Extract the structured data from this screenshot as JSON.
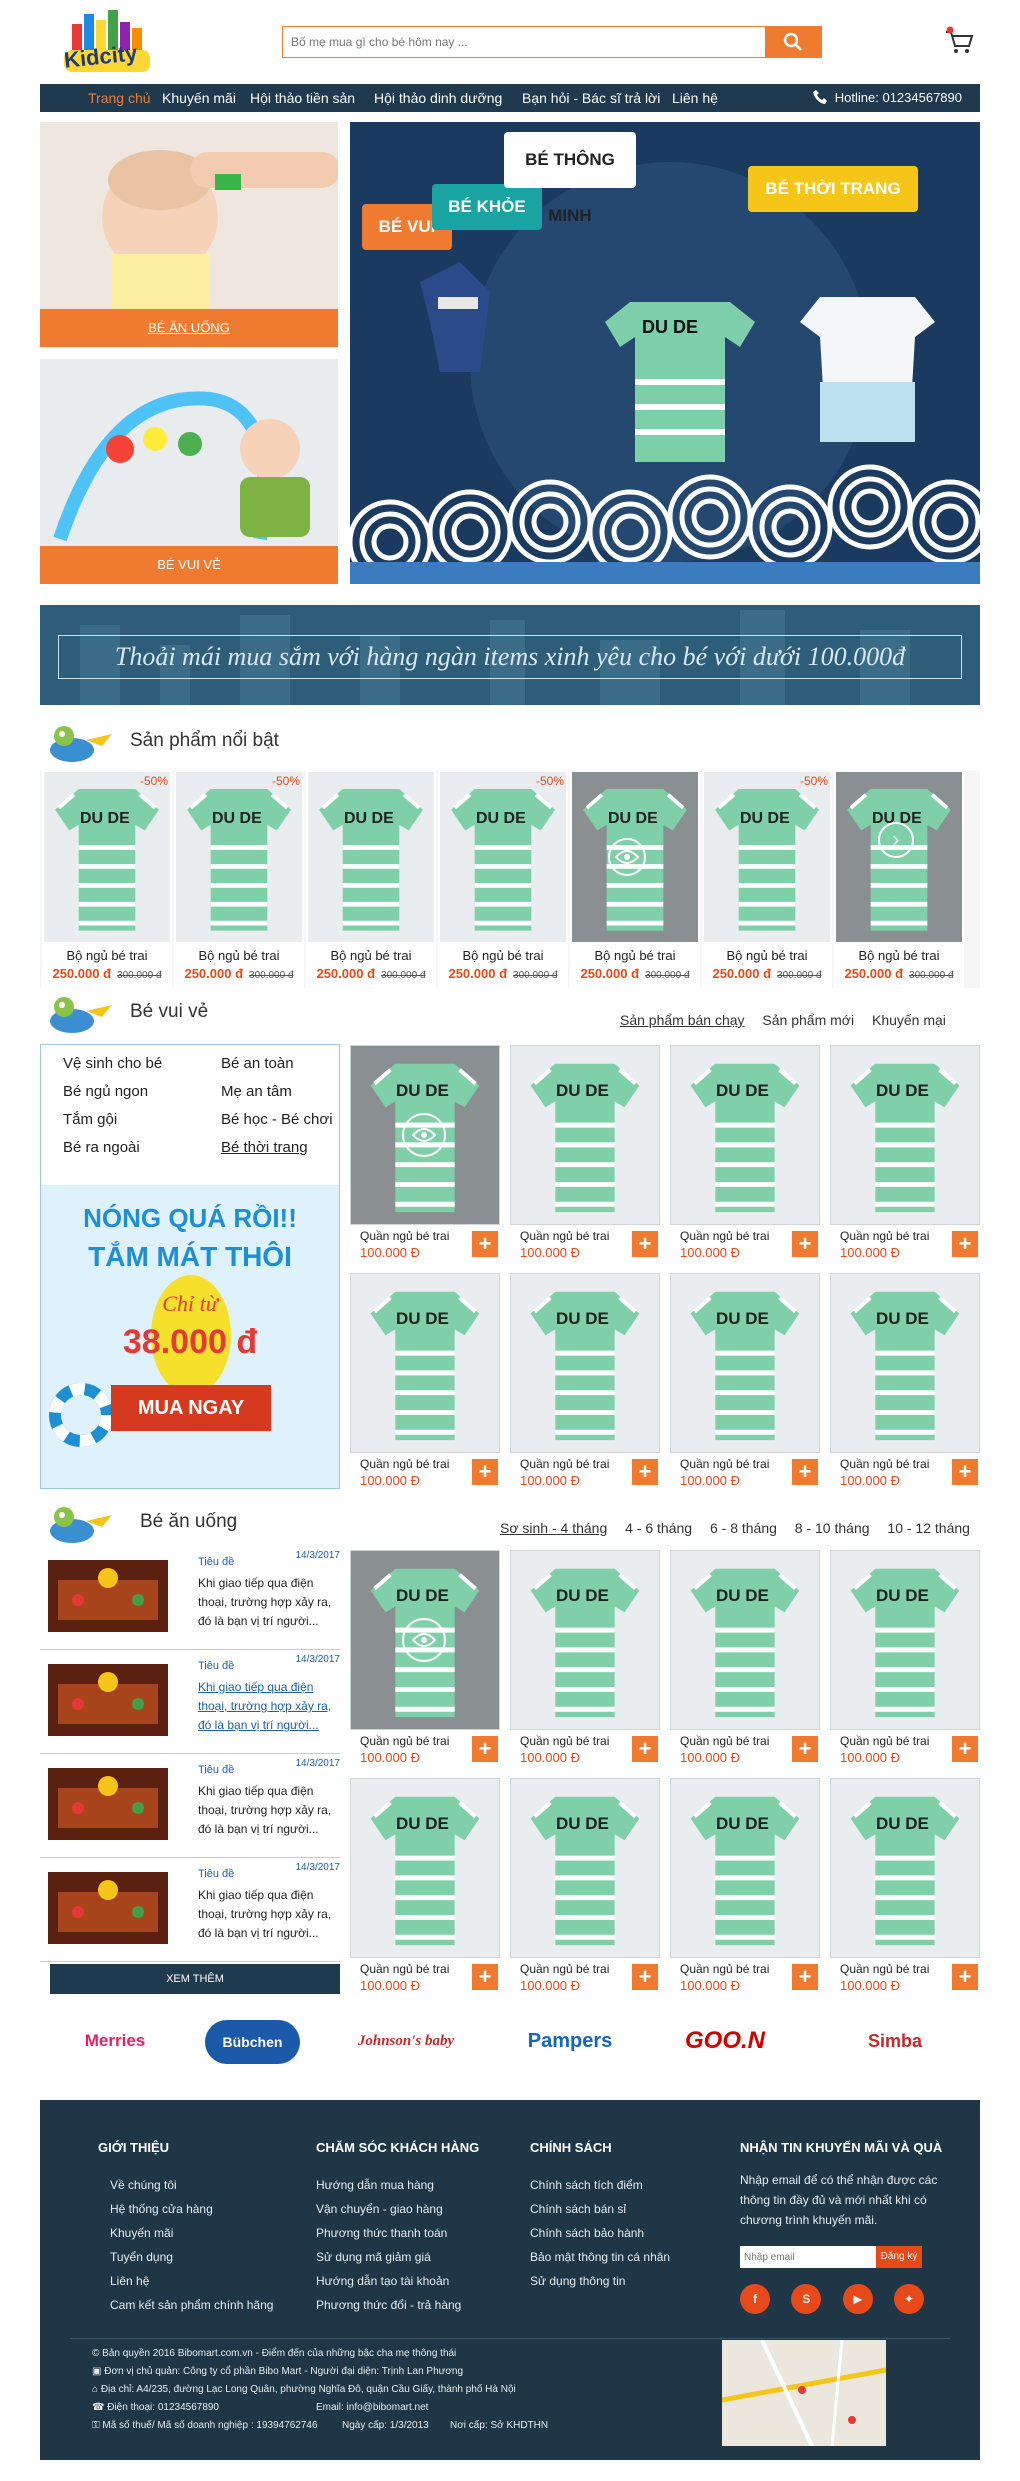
{
  "header": {
    "logo_text": "Kidcity",
    "search_placeholder": "Bố mẹ mua gì cho bé hôm nay ...",
    "hotline": "Hotline: 01234567890"
  },
  "nav": [
    "Trang chủ",
    "Khuyến mãi",
    "Hội thảo tiền sản",
    "Hội thảo dinh dưỡng",
    "Bạn hỏi - Bác sĩ trả lời",
    "Liên hệ"
  ],
  "hero": {
    "tile1": "BÉ ĂN UỐNG",
    "tile2": "BÉ VUI VẺ",
    "tags": [
      "BÉ VUI",
      "BÉ KHỎE",
      "BÉ THÔNG MINH",
      "BÉ THỜI TRANG"
    ],
    "shirt_text": "DU DE",
    "banner_text": "Thoải mái mua sắm với hàng ngàn items xinh yêu cho bé với dưới 100.000đ"
  },
  "featured": {
    "title": "Sản phẩm nổi bật",
    "items": [
      {
        "name": "Bộ ngủ bé trai",
        "price": "250.000 đ",
        "old": "300.000 đ",
        "sale": "-50%"
      },
      {
        "name": "Bộ ngủ bé trai",
        "price": "250.000 đ",
        "old": "300.000 đ",
        "sale": "-50%"
      },
      {
        "name": "Bộ ngủ bé trai",
        "price": "250.000 đ",
        "old": "300.000 đ",
        "sale": ""
      },
      {
        "name": "Bộ ngủ bé trai",
        "price": "250.000 đ",
        "old": "300.000 đ",
        "sale": "-50%"
      },
      {
        "name": "Bộ ngủ bé trai",
        "price": "250.000 đ",
        "old": "300.000 đ",
        "sale": ""
      },
      {
        "name": "Bộ ngủ bé trai",
        "price": "250.000 đ",
        "old": "300.000 đ",
        "sale": "-50%"
      },
      {
        "name": "Bộ ngủ bé trai",
        "price": "250.000 đ",
        "old": "300.000 đ",
        "sale": ""
      }
    ]
  },
  "vui": {
    "title": "Bé vui vẻ",
    "tabs": [
      "Sản phẩm bán chạy",
      "Sản phẩm mới",
      "Khuyến mại"
    ],
    "cats": [
      "Vệ sinh cho bé",
      "Bé ngủ ngon",
      "Tắm gội",
      "Bé ra ngoài",
      "Bé an toàn",
      "Mẹ an tâm",
      "Bé học - Bé chơi",
      "Bé thời trang"
    ],
    "promo_line1": "NÓNG QUÁ RỒI!!",
    "promo_line2": "TẮM MÁT THÔI",
    "promo_from": "Chỉ từ",
    "promo_price": "38.000 đ",
    "promo_btn": "MUA NGAY",
    "item_name": "Quần ngủ bé trai",
    "item_price": "100.000 Đ"
  },
  "an": {
    "title": "Bé ăn uống",
    "tabs": [
      "Sơ sinh - 4 tháng",
      "4 - 6 tháng",
      "6 - 8 tháng",
      "8 - 10 tháng",
      "10 - 12 tháng"
    ],
    "news": [
      {
        "title": "Tiêu đề",
        "date": "14/3/2017",
        "desc": "Khi giao tiếp qua điện thoại, trường hợp xảy ra, đó là bạn vị trí người..."
      },
      {
        "title": "Tiêu đề",
        "date": "14/3/2017",
        "desc": "Khi giao tiếp qua điện thoại, trường hợp xảy ra, đó là bạn vị trí người..."
      },
      {
        "title": "Tiêu đề",
        "date": "14/3/2017",
        "desc": "Khi giao tiếp qua điện thoại, trường hợp xảy ra, đó là bạn vị trí người..."
      },
      {
        "title": "Tiêu đề",
        "date": "14/3/2017",
        "desc": "Khi giao tiếp qua điện thoại, trường hợp xảy ra, đó là bạn vị trí người..."
      }
    ],
    "more": "XEM THÊM",
    "item_name": "Quần ngủ bé trai",
    "item_price": "100.000 Đ"
  },
  "brands": [
    "Merries",
    "Bübchen",
    "Johnson's baby",
    "Pampers",
    "GOO.N",
    "Simba"
  ],
  "footer": {
    "col1_title": "GIỚI THIỆU",
    "col1": [
      "Về chúng tôi",
      "Hệ thống cửa hàng",
      "Khuyến mãi",
      "Tuyển dụng",
      "Liên hệ",
      "Cam kết sản phẩm chính hãng"
    ],
    "col2_title": "CHĂM SÓC KHÁCH HÀNG",
    "col2": [
      "Hướng dẫn mua hàng",
      "Vận chuyển - giao hàng",
      "Phương thức thanh toán",
      "Sử dụng mã giảm giá",
      "Hướng dẫn tạo tài khoản",
      "Phương thức đổi - trả hàng"
    ],
    "col3_title": "CHÍNH SÁCH",
    "col3": [
      "Chính sách tích điểm",
      "Chính sách bán sỉ",
      "Chính sách bảo hành",
      "Bảo mật thông tin cá nhân",
      "Sử dụng thông tin"
    ],
    "col4_title": "NHẬN TIN KHUYẾN MÃI VÀ QUÀ",
    "col4_text": "Nhập email để có thể nhận được các thông tin đầy đủ và mới nhất khi có chương trình khuyến mãi.",
    "email_placeholder": "Nhập email",
    "signup": "Đăng ký",
    "copy": [
      "Bản quyền 2016 Bibomart.com.vn - Điểm đến của những bậc cha mẹ thông thái",
      "Đơn vị chủ quản: Công ty cổ phần Bibo Mart - Người đại diện: Trịnh Lan Phương",
      "Địa chỉ: A4/235, đường Lạc Long Quân, phường Nghĩa Đô, quận Cầu Giấy, thành phố Hà Nội",
      "Điện thoại: 01234567890",
      "Email: info@bibomart.net",
      "Mã số thuế/ Mã số doanh nghiệp : 19394762746",
      "Ngày cấp: 1/3/2013",
      "Nơi cấp: Sở KHDTHN"
    ]
  },
  "colors": {
    "accent": "#f07b30",
    "navy": "#1f3a4f",
    "teal": "#2b5a74"
  }
}
